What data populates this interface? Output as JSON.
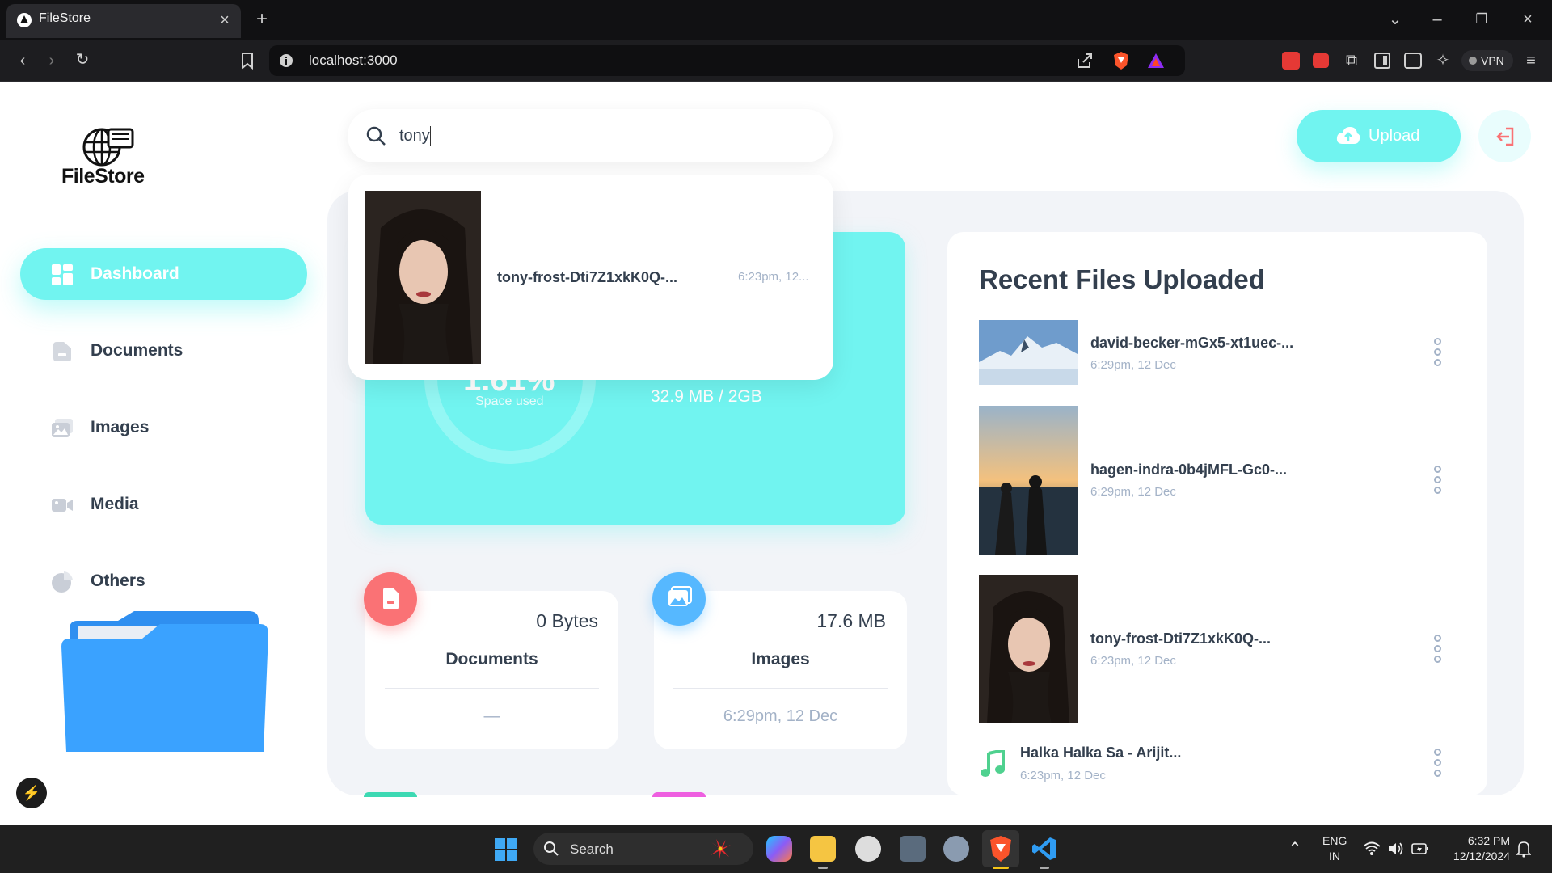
{
  "browser": {
    "tab_title": "FileStore",
    "url": "localhost:3000",
    "vpn_label": "VPN"
  },
  "sidebar": {
    "logo_text": "FileStore",
    "items": [
      {
        "label": "Dashboard",
        "active": true
      },
      {
        "label": "Documents",
        "active": false
      },
      {
        "label": "Images",
        "active": false
      },
      {
        "label": "Media",
        "active": false
      },
      {
        "label": "Others",
        "active": false
      }
    ]
  },
  "search": {
    "value": "tony",
    "results": [
      {
        "name": "tony-frost-Dti7Z1xkK0Q-...",
        "date": "6:23pm, 12..."
      }
    ]
  },
  "header": {
    "upload_label": "Upload"
  },
  "storage": {
    "percent_label": "1.61%",
    "space_used_label": "Space used",
    "size_label": "32.9 MB / 2GB"
  },
  "summary": [
    {
      "size": "0 Bytes",
      "title": "Documents",
      "date": "—",
      "color": "#fa7275"
    },
    {
      "size": "17.6 MB",
      "title": "Images",
      "date": "6:29pm, 12 Dec",
      "color": "#56b8ff"
    }
  ],
  "recent": {
    "title": "Recent Files Uploaded",
    "files": [
      {
        "name": "david-becker-mGx5-xt1uec-...",
        "date": "6:29pm, 12 Dec"
      },
      {
        "name": "hagen-indra-0b4jMFL-Gc0-...",
        "date": "6:29pm, 12 Dec"
      },
      {
        "name": "tony-frost-Dti7Z1xkK0Q-...",
        "date": "6:23pm, 12 Dec"
      },
      {
        "name": "Halka Halka Sa - Arijit...",
        "date": "6:23pm, 12 Dec"
      }
    ]
  },
  "taskbar": {
    "search_label": "Search",
    "lang_line1": "ENG",
    "lang_line2": "IN",
    "time": "6:32 PM",
    "date": "12/12/2024"
  },
  "colors": {
    "brand": "#71f4f0",
    "text": "#333f4e",
    "muted": "#a3b2c7",
    "documents": "#fa7275",
    "images": "#56b8ff"
  }
}
